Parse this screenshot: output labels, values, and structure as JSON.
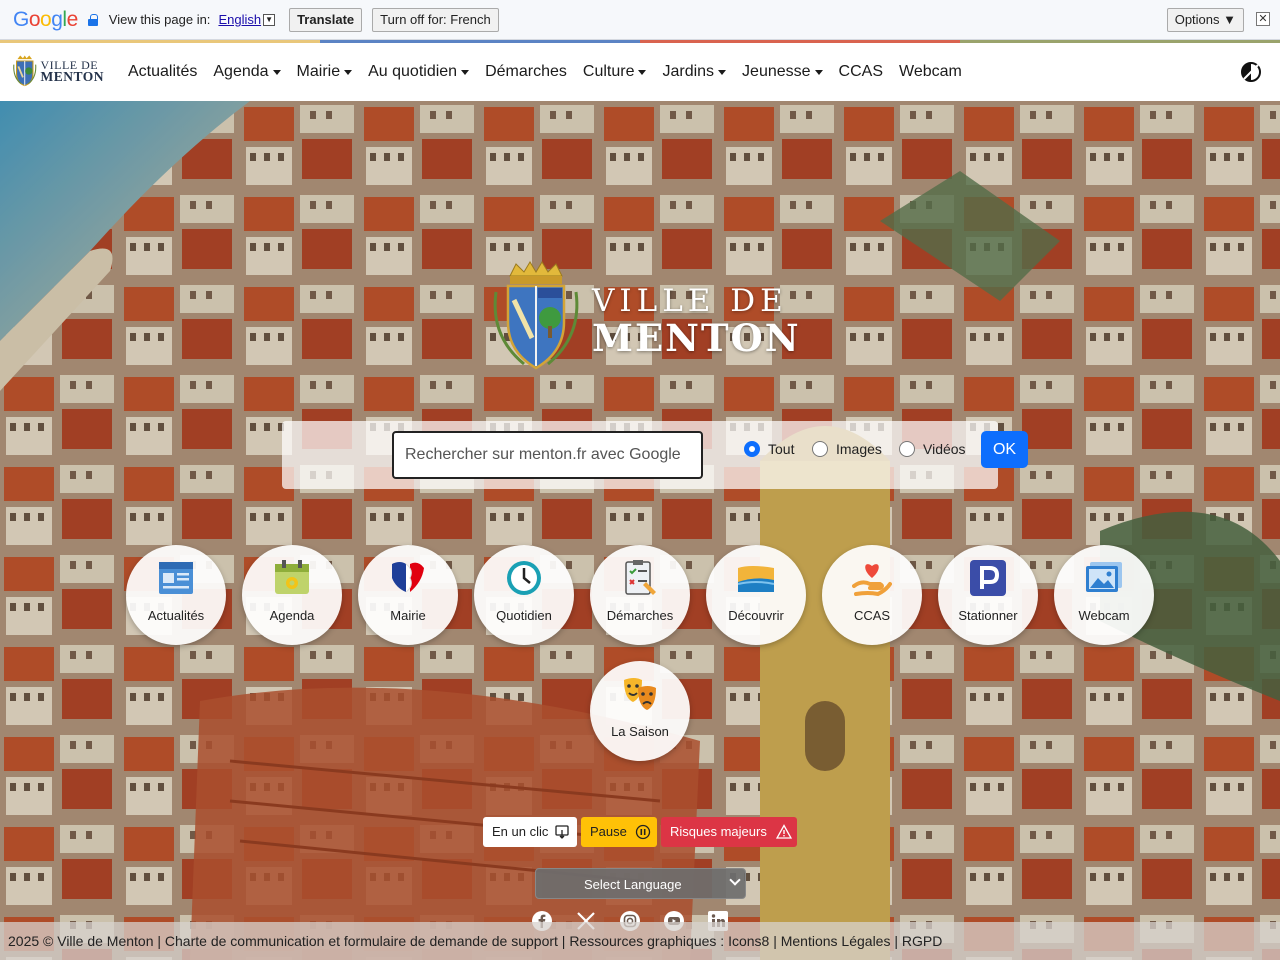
{
  "translate_bar": {
    "logo": "Google",
    "prompt": "View this page in:",
    "language": "English",
    "translate_button": "Translate",
    "turn_off_button": "Turn off for: French",
    "options_button": "Options ▼",
    "close_icon": "close-icon"
  },
  "site": {
    "logo_line1": "VILLE DE",
    "logo_line2": "MENTON",
    "nav": [
      {
        "label": "Actualités",
        "dropdown": false
      },
      {
        "label": "Agenda",
        "dropdown": true
      },
      {
        "label": "Mairie",
        "dropdown": true
      },
      {
        "label": "Au quotidien",
        "dropdown": true
      },
      {
        "label": "Démarches",
        "dropdown": false
      },
      {
        "label": "Culture",
        "dropdown": true
      },
      {
        "label": "Jardins",
        "dropdown": true
      },
      {
        "label": "Jeunesse",
        "dropdown": true
      },
      {
        "label": "CCAS",
        "dropdown": false
      },
      {
        "label": "Webcam",
        "dropdown": false
      }
    ],
    "contrast_icon": "contrast-icon"
  },
  "hero": {
    "title_line1": "VILLE DE",
    "title_line2": "MENTON"
  },
  "search": {
    "placeholder": "Rechercher sur menton.fr avec Google",
    "options": [
      {
        "label": "Tout",
        "selected": true
      },
      {
        "label": "Images",
        "selected": false
      },
      {
        "label": "Vidéos",
        "selected": false
      }
    ],
    "submit": "OK"
  },
  "quick_links": [
    {
      "label": "Actualités",
      "icon": "news-icon"
    },
    {
      "label": "Agenda",
      "icon": "calendar-icon"
    },
    {
      "label": "Mairie",
      "icon": "marianne-icon"
    },
    {
      "label": "Quotidien",
      "icon": "clock-icon"
    },
    {
      "label": "Démarches",
      "icon": "checklist-icon"
    },
    {
      "label": "Découvrir",
      "icon": "beach-icon"
    },
    {
      "label": "CCAS",
      "icon": "heart-hand-icon"
    },
    {
      "label": "Stationner",
      "icon": "parking-icon"
    },
    {
      "label": "Webcam",
      "icon": "image-icon"
    },
    {
      "label": "La Saison",
      "icon": "theater-masks-icon"
    }
  ],
  "pills": [
    {
      "label": "En un clic",
      "icon": "touch-icon"
    },
    {
      "label": "Pause",
      "icon": "pause-icon"
    },
    {
      "label": "Risques majeurs",
      "icon": "warning-icon"
    }
  ],
  "language_select": "Select Language",
  "social": [
    "facebook-icon",
    "x-icon",
    "instagram-icon",
    "youtube-icon",
    "linkedin-icon"
  ],
  "footer": "2025 © Ville de Menton | Charte de communication et formulaire de demande de support | Ressources graphiques : Icons8 | Mentions Légales | RGPD",
  "colors": {
    "primary_blue": "#0d6efd",
    "pause_yellow": "#ffc107",
    "risk_red": "#dc3545",
    "roof_terracotta": "#c2562f"
  }
}
